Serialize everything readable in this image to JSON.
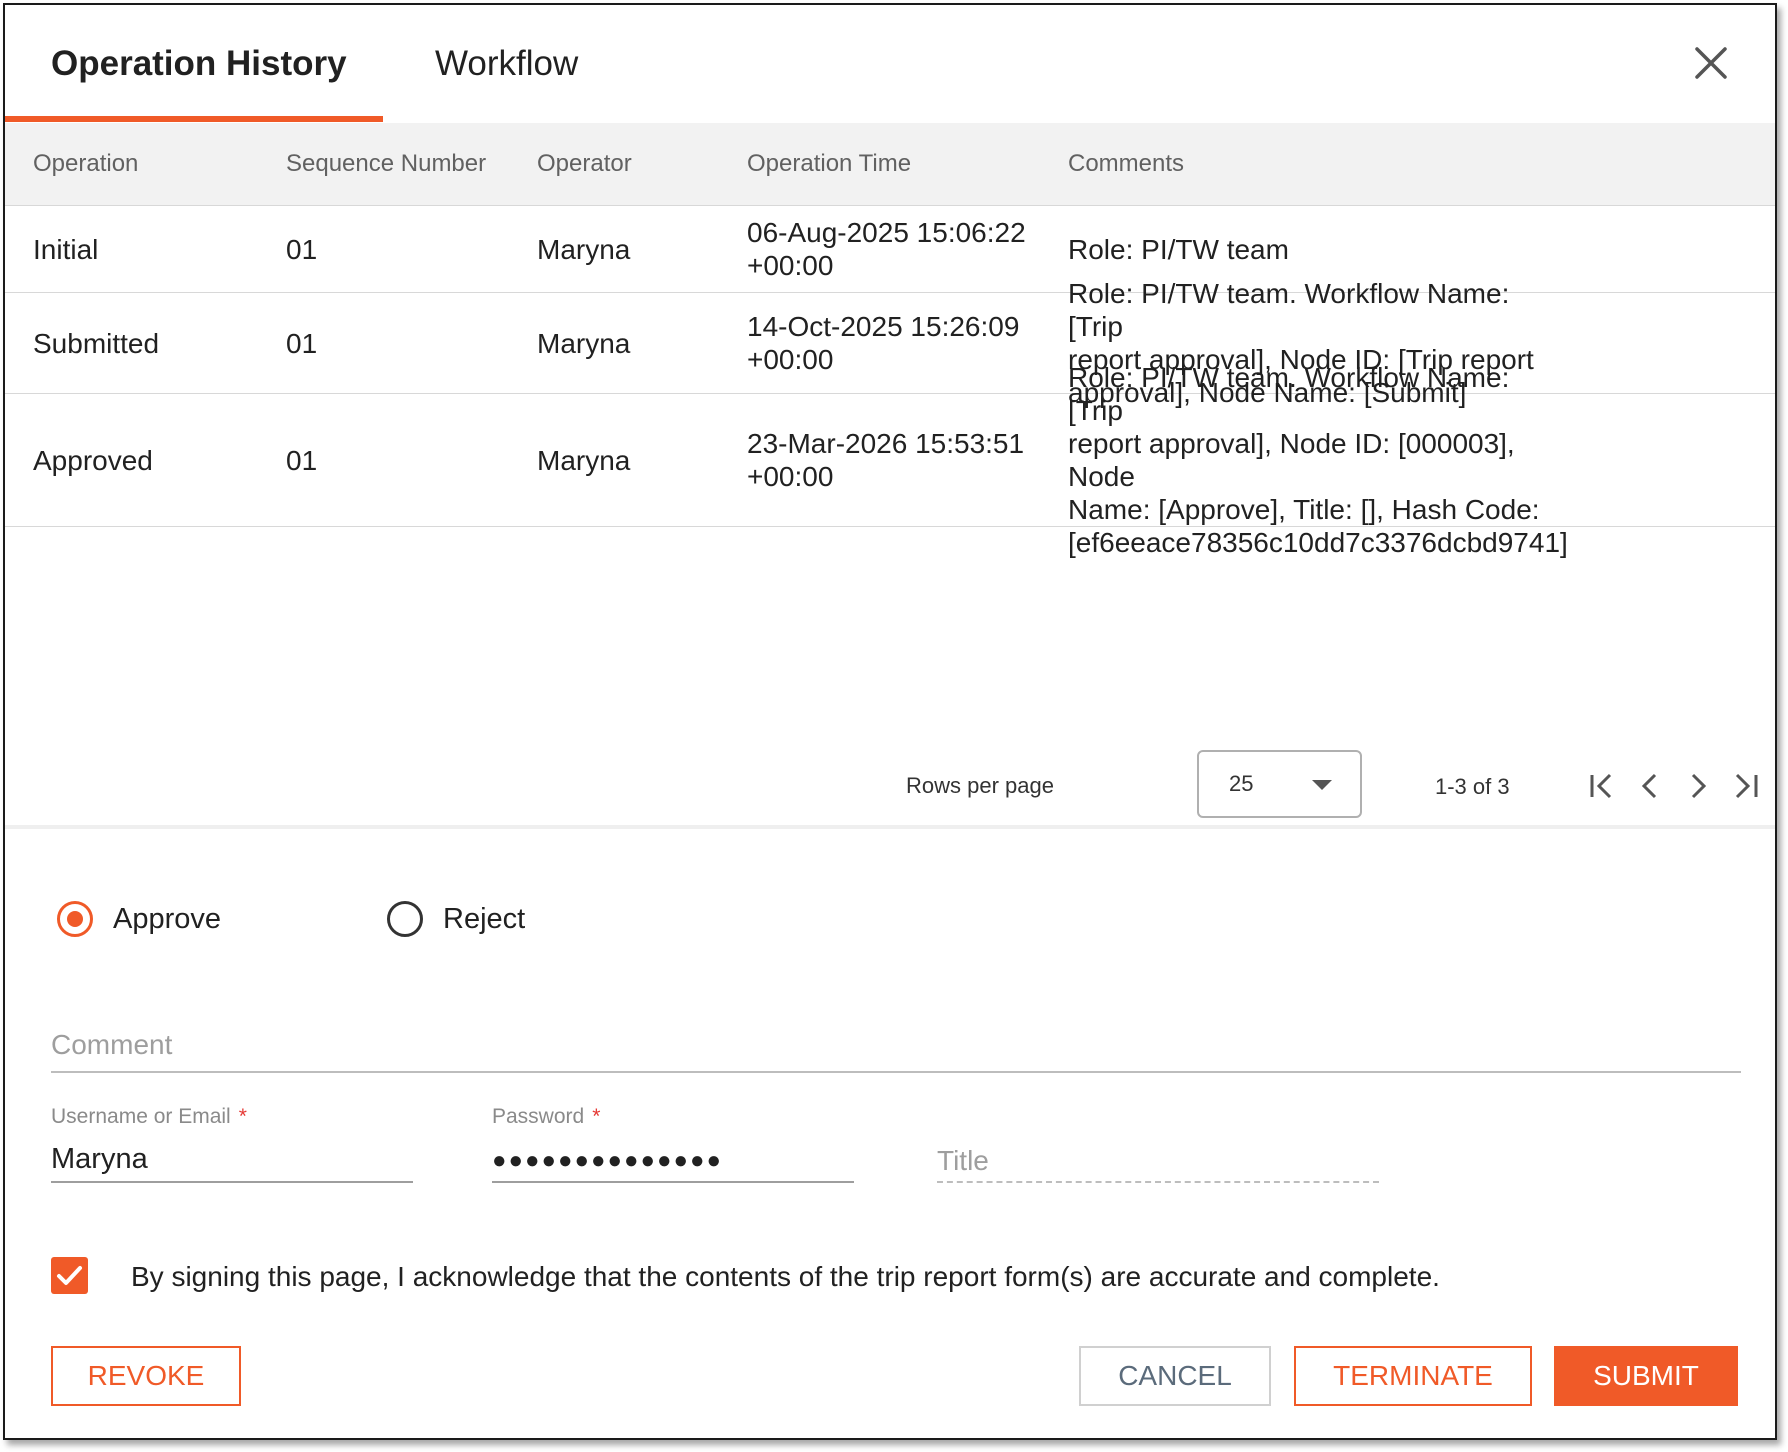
{
  "tabs": [
    {
      "label": "Operation History",
      "active": true
    },
    {
      "label": "Workflow",
      "active": false
    }
  ],
  "table": {
    "columns": [
      "Operation",
      "Sequence Number",
      "Operator",
      "Operation Time",
      "Comments"
    ],
    "rows": [
      {
        "operation": "Initial",
        "sequence": "01",
        "operator": "Maryna",
        "time": [
          "06-Aug-2025 15:06:22",
          "+00:00"
        ],
        "comments": [
          "Role: PI/TW team"
        ]
      },
      {
        "operation": "Submitted",
        "sequence": "01",
        "operator": "Maryna",
        "time": [
          "14-Oct-2025 15:26:09",
          "+00:00"
        ],
        "comments": [
          "Role: PI/TW team. Workflow Name: [Trip",
          "report approval], Node ID: [Trip report",
          "approval], Node Name: [Submit]"
        ]
      },
      {
        "operation": "Approved",
        "sequence": "01",
        "operator": "Maryna",
        "time": [
          "23-Mar-2026 15:53:51",
          "+00:00"
        ],
        "comments": [
          "Role: PI/TW team. Workflow Name: [Trip",
          "report approval], Node ID: [000003], Node",
          "Name: [Approve], Title: [], Hash Code:",
          "[ef6eeace78356c10dd7c3376dcbd9741]"
        ]
      }
    ]
  },
  "pagination": {
    "rows_per_page_label": "Rows per page",
    "rows_per_page": "25",
    "range": "1-3 of 3"
  },
  "decision": {
    "options": [
      "Approve",
      "Reject"
    ],
    "selected": "Approve"
  },
  "form": {
    "comment_placeholder": "Comment",
    "username_label": "Username or Email",
    "username_value": "Maryna",
    "password_label": "Password",
    "password_value": "●●●●●●●●●●●●●●",
    "required_mark": "*",
    "title_placeholder": "Title"
  },
  "acknowledgement": {
    "checked": true,
    "text": "By signing this page, I acknowledge that the contents of the trip report form(s) are accurate and complete."
  },
  "buttons": {
    "revoke": "REVOKE",
    "cancel": "CANCEL",
    "terminate": "TERMINATE",
    "submit": "SUBMIT"
  },
  "colors": {
    "accent": "#f05a28",
    "header_bg": "#f2f2f2",
    "required": "#e53935"
  }
}
